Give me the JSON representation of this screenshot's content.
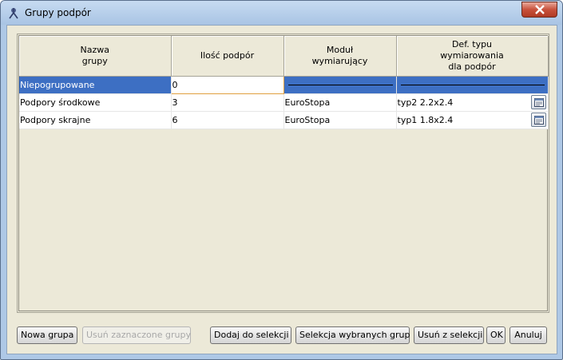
{
  "window": {
    "title": "Grupy podpór"
  },
  "table": {
    "columns": [
      {
        "lines": [
          "Nazwa",
          "grupy"
        ]
      },
      {
        "lines": [
          "Ilość podpór"
        ]
      },
      {
        "lines": [
          "Moduł",
          "wymiarujący"
        ]
      },
      {
        "lines": [
          "Def. typu",
          "wymiarowania",
          "dla podpór"
        ]
      }
    ],
    "rows": [
      {
        "name": "Niepogrupowane",
        "count": "0",
        "module": "",
        "def_type": "",
        "selected": true
      },
      {
        "name": "Podpory środkowe",
        "count": "3",
        "module": "EuroStopa",
        "def_type": "typ2 2.2x2.4",
        "selected": false
      },
      {
        "name": "Podpory skrajne",
        "count": "6",
        "module": "EuroStopa",
        "def_type": "typ1 1.8x2.4",
        "selected": false
      }
    ]
  },
  "buttons": {
    "new_group": "Nowa grupa",
    "delete_selected": "Usuń zaznaczone grupy",
    "add_to_selection": "Dodaj do selekcji",
    "select_groups": "Selekcja wybranych grup",
    "remove_from_selection": "Usuń z selekcji",
    "ok": "OK",
    "cancel": "Anuluj"
  }
}
